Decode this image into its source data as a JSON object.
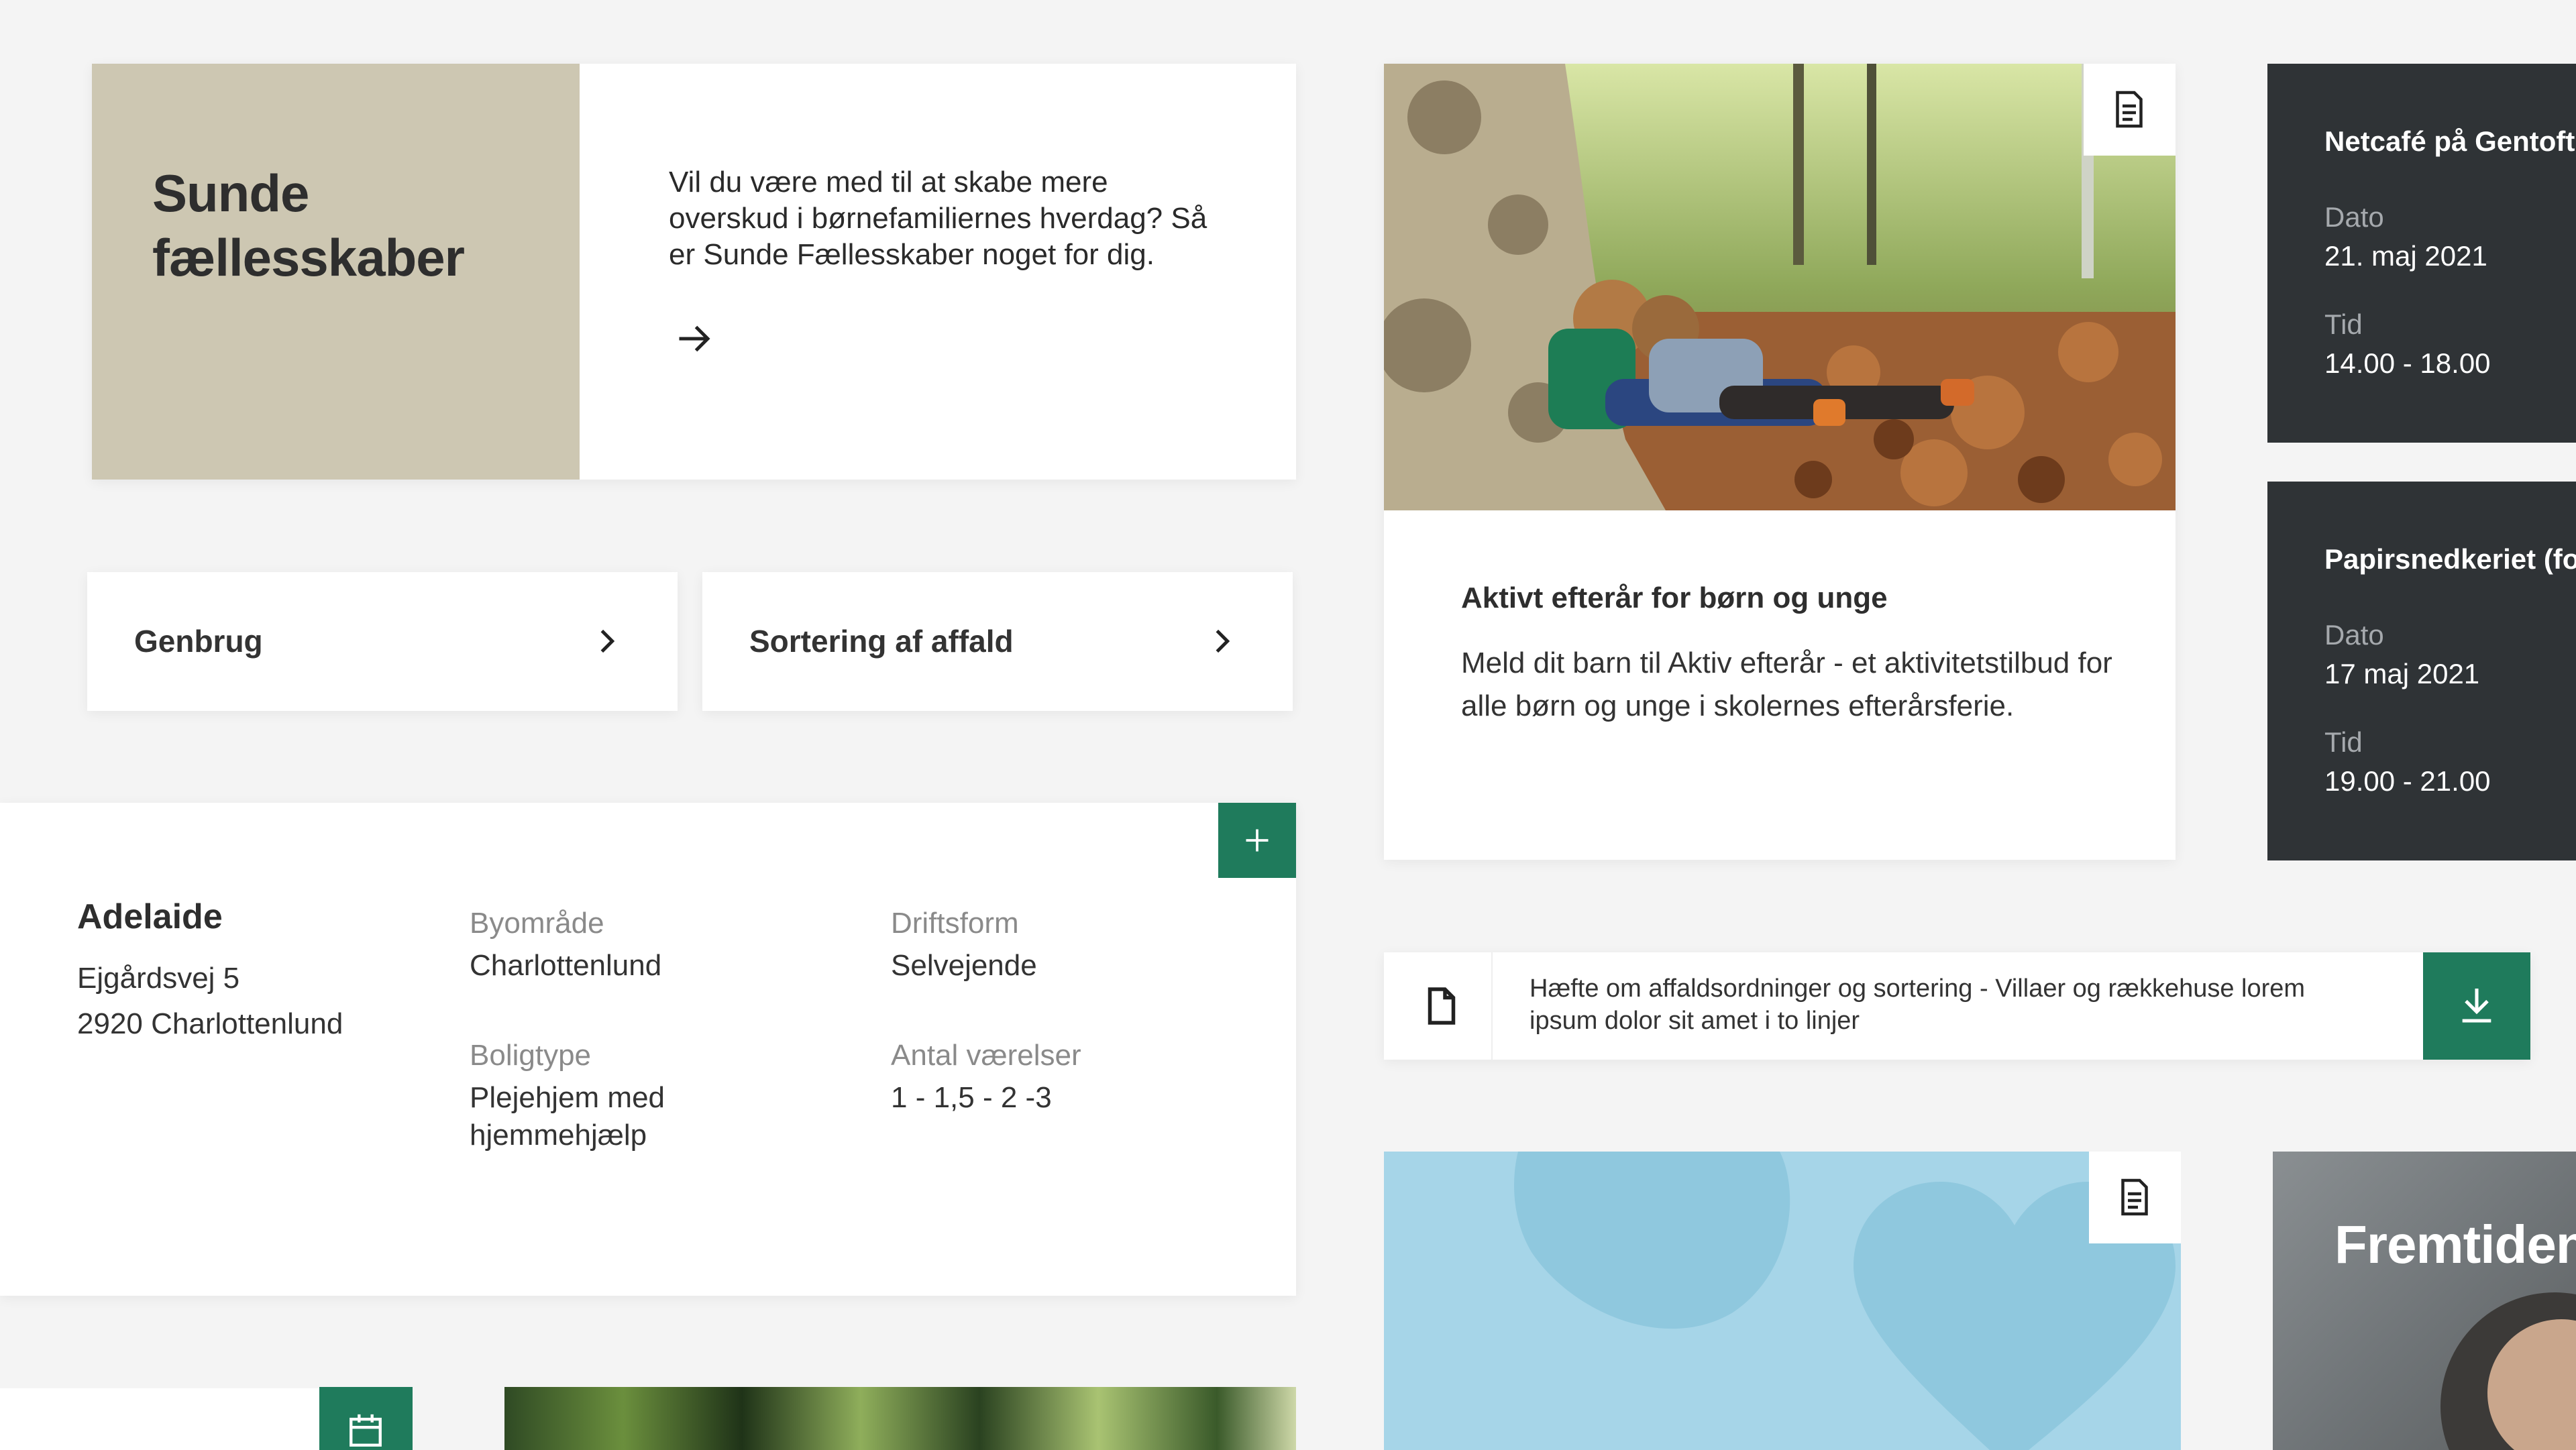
{
  "sunde_card": {
    "title": "Sunde fællesskaber",
    "text": "Vil du være med til at skabe mere overskud i børnefamiliernes hverdag? Så er Sunde Fællesskaber noget for dig.",
    "arrow_icon": "arrow-right-icon",
    "accent_color": "#cdc7b2"
  },
  "link_cards": [
    {
      "label": "Genbrug",
      "icon": "chevron-right-icon"
    },
    {
      "label": "Sortering af affald",
      "icon": "chevron-right-icon"
    }
  ],
  "adelaide": {
    "name": "Adelaide",
    "street": "Ejgårdsvej 5",
    "city": "2920 Charlottenlund",
    "byomraade_label": "Byområde",
    "byomraade_value": "Charlottenlund",
    "driftsform_label": "Driftsform",
    "driftsform_value": "Selvejende",
    "boligtype_label": "Boligtype",
    "boligtype_value": "Plejehjem med hjemmehjælp",
    "vaerelser_label": "Antal værelser",
    "vaerelser_value": "1 - 1,5 - 2 -3",
    "plus_icon": "plus-icon",
    "accent_color": "#1f7b5c"
  },
  "aktivt_card": {
    "title": "Aktivt efterår for børn og unge",
    "text": "Meld dit barn til Aktiv efterår - et aktivitetstilbud for alle børn og unge i skolernes efterårsferie.",
    "badge_icon": "document-icon"
  },
  "events": [
    {
      "title": "Netcafé på Gentofte Hovedbibliotek",
      "date_label": "Dato",
      "date": "21. maj 2021",
      "time_label": "Tid",
      "time": "14.00 - 18.00"
    },
    {
      "title": "Papirsnedkeriet (for børn)",
      "date_label": "Dato",
      "date": "17 maj 2021",
      "time_label": "Tid",
      "time": "19.00 - 21.00"
    }
  ],
  "download": {
    "text": "Hæfte om affaldsordninger og sortering - Villaer og rækkehuse lorem ipsum dolor sit amet i to linjer",
    "file_icon": "file-icon",
    "button_icon": "download-icon"
  },
  "blue_card": {
    "badge_icon": "document-icon",
    "bg_color": "#a6d5e8"
  },
  "fremtidens": {
    "title": "Fremtidens transport"
  },
  "bottom_left": {
    "calendar_icon": "calendar-icon"
  }
}
